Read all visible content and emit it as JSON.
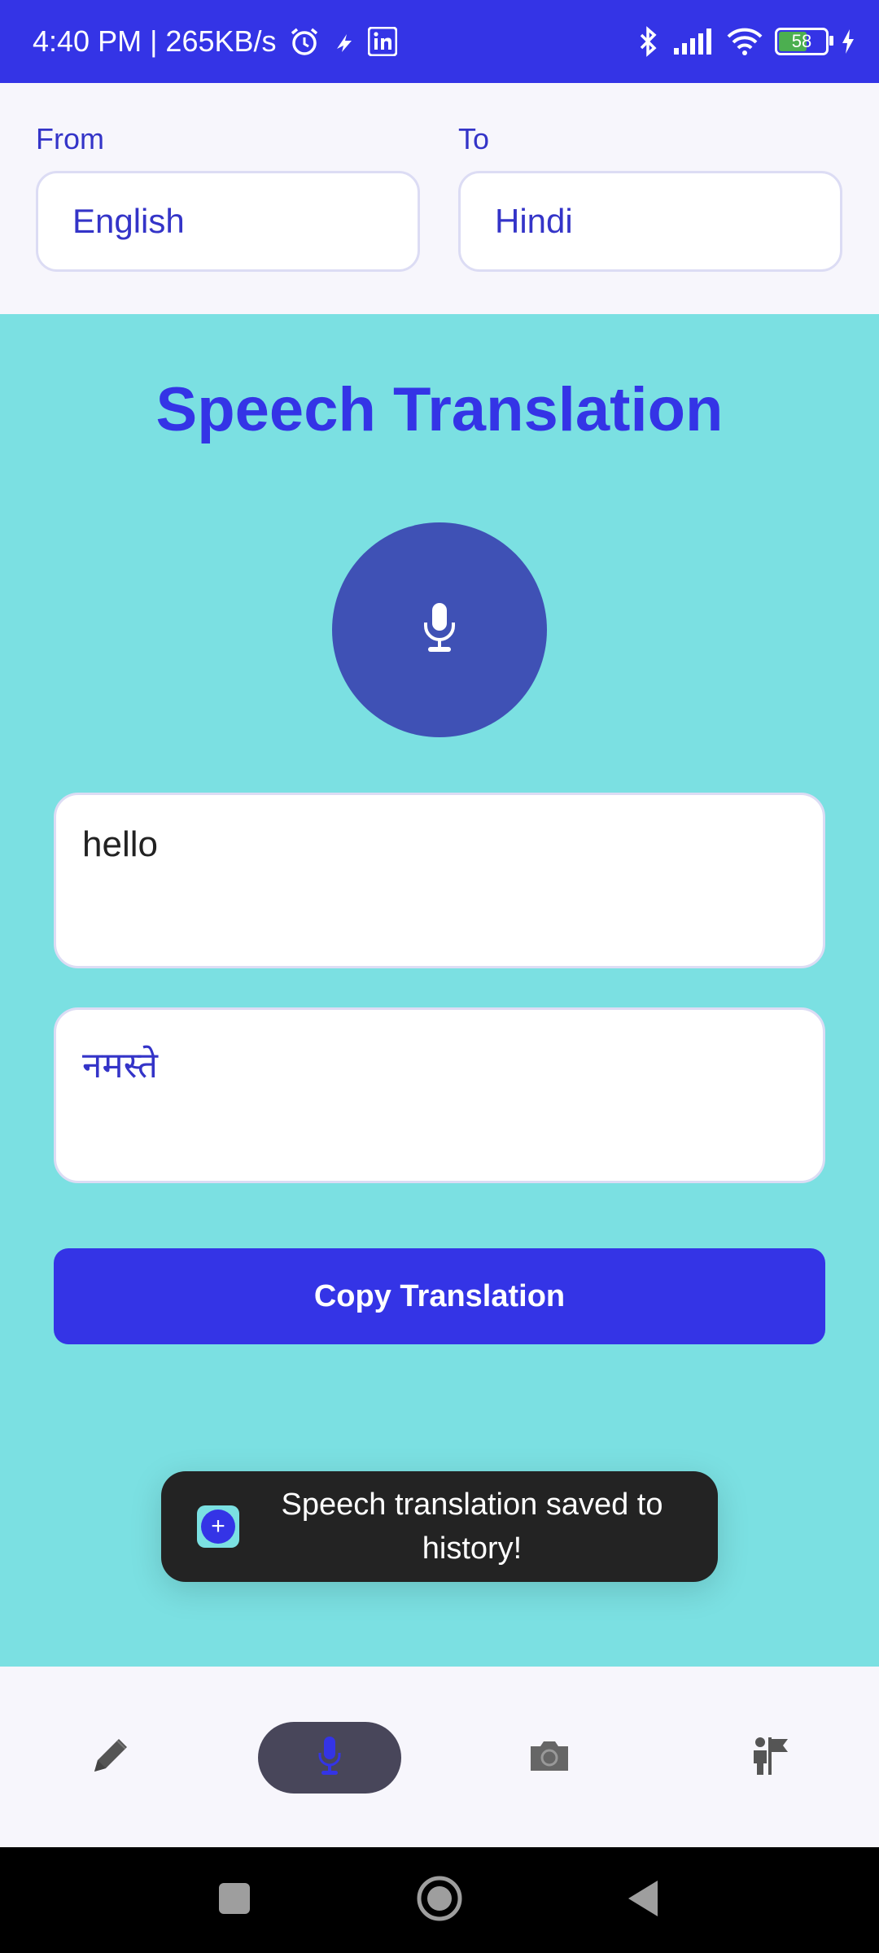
{
  "status_bar": {
    "time_speed": "4:40 PM | 265KB/s",
    "battery_level": "58",
    "icons": [
      "alarm-icon",
      "fastcharge-icon",
      "linkedin-icon",
      "bluetooth-icon",
      "signal-icon",
      "wifi-icon",
      "battery-icon",
      "charging-icon"
    ]
  },
  "language": {
    "from_label": "From",
    "from_value": "English",
    "to_label": "To",
    "to_value": "Hindi"
  },
  "main": {
    "title": "Speech Translation",
    "mic_icon": "microphone-icon",
    "source_text": "hello",
    "translated_text": "नमस्ते",
    "copy_button_label": "Copy Translation"
  },
  "toast": {
    "icon": "app-icon",
    "message": "Speech translation saved to history!"
  },
  "bottom_nav": {
    "items": [
      {
        "icon": "pencil-icon",
        "active": false
      },
      {
        "icon": "microphone-icon",
        "active": true
      },
      {
        "icon": "camera-icon",
        "active": false
      },
      {
        "icon": "history-icon",
        "active": false
      }
    ]
  },
  "colors": {
    "primary": "#3434e6",
    "accent_bg": "#7be0e2",
    "mic_button": "#3f51b5",
    "nav_active": "#48465a"
  }
}
